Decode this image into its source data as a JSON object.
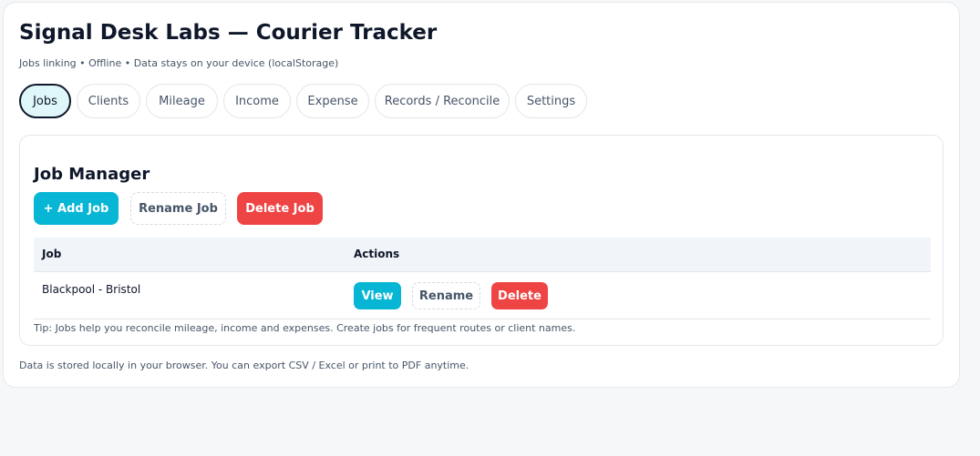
{
  "app": {
    "title": "Signal Desk Labs — Courier Tracker",
    "subtitle": "Jobs linking • Offline • Data stays on your device (localStorage)"
  },
  "tabs": [
    {
      "label": "Jobs",
      "active": true
    },
    {
      "label": "Clients"
    },
    {
      "label": "Mileage"
    },
    {
      "label": "Income"
    },
    {
      "label": "Expense"
    },
    {
      "label": "Records / Reconcile"
    },
    {
      "label": "Settings"
    }
  ],
  "job_manager": {
    "title": "Job Manager",
    "add_label": "+ Add Job",
    "rename_label": "Rename Job",
    "delete_label": "Delete Job",
    "table": {
      "headers": [
        "Job",
        "Actions"
      ],
      "rows": [
        {
          "job": "Blackpool - Bristol",
          "view": "View",
          "rename": "Rename",
          "delete": "Delete"
        }
      ]
    },
    "tip": "Tip: Jobs help you reconcile mileage, income and expenses. Create jobs for frequent routes or client names."
  },
  "footer": "Data is stored locally in your browser. You can export CSV / Excel or print to PDF anytime.",
  "colors": {
    "accent": "#06b6d4",
    "danger": "#ef4444",
    "active_tab_bg": "#e0f7fa"
  }
}
